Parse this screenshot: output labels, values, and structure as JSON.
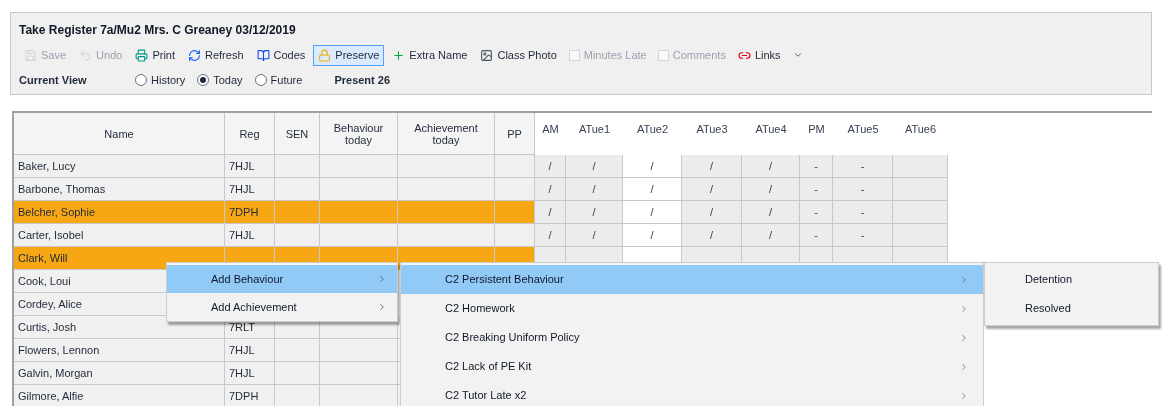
{
  "window": {
    "title": "Take Register 7a/Mu2 Mrs. C Greaney 03/12/2019"
  },
  "toolbar": [
    {
      "label": "Save",
      "kind": "button",
      "disabled": true,
      "pressed": false
    },
    {
      "label": "Undo",
      "kind": "button",
      "disabled": true,
      "pressed": false
    },
    {
      "label": "Print",
      "kind": "button",
      "disabled": false,
      "pressed": false
    },
    {
      "label": "Refresh",
      "kind": "button",
      "disabled": false,
      "pressed": false
    },
    {
      "label": "Codes",
      "kind": "button",
      "disabled": false,
      "pressed": false
    },
    {
      "label": "Preserve",
      "kind": "button",
      "disabled": false,
      "pressed": true
    },
    {
      "label": "Extra Name",
      "kind": "button",
      "disabled": false,
      "pressed": false
    },
    {
      "label": "Class Photo",
      "kind": "button",
      "disabled": false,
      "pressed": false
    },
    {
      "label": "Minutes Late",
      "kind": "checkbox",
      "disabled": true,
      "checked": false
    },
    {
      "label": "Comments",
      "kind": "checkbox",
      "disabled": true,
      "checked": false
    },
    {
      "label": "Links",
      "kind": "dropdown",
      "disabled": false,
      "pressed": false
    }
  ],
  "view": {
    "label": "Current View",
    "options": [
      {
        "label": "History",
        "selected": false
      },
      {
        "label": "Today",
        "selected": true
      },
      {
        "label": "Future",
        "selected": false
      }
    ],
    "present": "Present 26"
  },
  "table": {
    "columns": [
      "Name",
      "Reg",
      "SEN",
      "Behaviour today",
      "Achievement today",
      "PP",
      "AM",
      "ATue1",
      "ATue2",
      "ATue3",
      "ATue4",
      "PM",
      "ATue5",
      "ATue6"
    ],
    "rows": [
      {
        "name": "Baker, Lucy",
        "reg": "7HJL",
        "flagged": false,
        "marks": [
          "/",
          "/",
          "/",
          "/",
          "/",
          "-",
          "-"
        ]
      },
      {
        "name": "Barbone, Thomas",
        "reg": "7HJL",
        "flagged": false,
        "marks": [
          "/",
          "/",
          "/",
          "/",
          "/",
          "-",
          "-"
        ]
      },
      {
        "name": "Belcher, Sophie",
        "reg": "7DPH",
        "flagged": true,
        "marks": [
          "/",
          "/",
          "/",
          "/",
          "/",
          "-",
          "-"
        ]
      },
      {
        "name": "Carter, Isobel",
        "reg": "7HJL",
        "flagged": false,
        "marks": [
          "/",
          "/",
          "/",
          "/",
          "/",
          "-",
          "-"
        ]
      },
      {
        "name": "Clark, Will",
        "flagged": true
      },
      {
        "name": "Cook, Loui",
        "flagged": false
      },
      {
        "name": "Cordey, Alice",
        "flagged": false
      },
      {
        "name": "Curtis, Josh",
        "reg": "7RLT",
        "flagged": false
      },
      {
        "name": "Flowers, Lennon",
        "reg": "7HJL",
        "flagged": false
      },
      {
        "name": "Galvin, Morgan",
        "reg": "7HJL",
        "flagged": false
      },
      {
        "name": "Gilmore, Alfie",
        "reg": "7DPH",
        "flagged": false
      }
    ]
  },
  "context_menu": {
    "items": [
      {
        "label": "Add Behaviour",
        "selected": true
      },
      {
        "label": "Add Achievement",
        "selected": false
      }
    ],
    "submenu": [
      {
        "label": "C2 Persistent Behaviour",
        "selected": true
      },
      {
        "label": "C2 Homework",
        "selected": false
      },
      {
        "label": "C2 Breaking Uniform Policy",
        "selected": false
      },
      {
        "label": "C2 Lack of PE Kit",
        "selected": false
      },
      {
        "label": "C2 Tutor Late x2",
        "selected": false
      }
    ],
    "subsubmenu": [
      {
        "label": "Detention",
        "selected": false
      },
      {
        "label": "Resolved",
        "selected": false
      }
    ]
  }
}
